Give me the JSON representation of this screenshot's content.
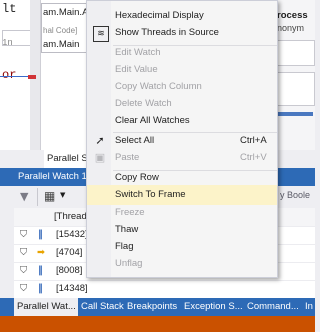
{
  "editor": {
    "code_lines": [
      "lt",
      "1n",
      "or"
    ],
    "colors": {
      "keyword": "#8b0000",
      "accent": "#d13438"
    }
  },
  "callstack_panel": {
    "rows": [
      "am.Main.Ar",
      "hal Code]",
      "am.Main"
    ]
  },
  "right_panel": {
    "header": "rocess",
    "subtext": "nonym"
  },
  "parallel_stacks_tab": "Parallel St",
  "parallel_watch": {
    "title": "Parallel Watch 1 -",
    "search_placeholder": "y Boole",
    "column_header": "[Thread",
    "rows": [
      {
        "thread": "[15432]",
        "icon": "pause-icon"
      },
      {
        "thread": "[4704]",
        "icon": "current-thread-arrow-icon"
      },
      {
        "thread": "[8008]",
        "icon": "pause-icon"
      },
      {
        "thread": "[14348]",
        "icon": "pause-icon"
      }
    ]
  },
  "bottom_tabs": [
    {
      "label": "Parallel Wat...",
      "active": true
    },
    {
      "label": "Call Stack",
      "active": false
    },
    {
      "label": "Breakpoints",
      "active": false
    },
    {
      "label": "Exception S...",
      "active": false
    },
    {
      "label": "Command...",
      "active": false
    },
    {
      "label": "In",
      "active": false
    }
  ],
  "context_menu": {
    "items": [
      {
        "label": "Hexadecimal Display",
        "enabled": true,
        "icon": ""
      },
      {
        "label": "Show Threads in Source",
        "enabled": true,
        "icon": "threads-in-source-icon"
      },
      {
        "label": "Edit Watch",
        "enabled": false
      },
      {
        "label": "Edit Value",
        "enabled": false
      },
      {
        "label": "Copy Watch Column",
        "enabled": false
      },
      {
        "label": "Delete Watch",
        "enabled": false
      },
      {
        "label": "Clear All Watches",
        "enabled": true
      },
      {
        "label": "Select All",
        "enabled": true,
        "shortcut": "Ctrl+A",
        "icon": "cursor-icon"
      },
      {
        "label": "Paste",
        "enabled": false,
        "shortcut": "Ctrl+V",
        "icon": "paste-icon"
      },
      {
        "label": "Copy Row",
        "enabled": true
      },
      {
        "label": "Switch To Frame",
        "enabled": true,
        "highlighted": true
      },
      {
        "label": "Freeze",
        "enabled": false
      },
      {
        "label": "Thaw",
        "enabled": true
      },
      {
        "label": "Flag",
        "enabled": true
      },
      {
        "label": "Unflag",
        "enabled": false
      }
    ]
  },
  "theme": {
    "title_bar_color": "#2d6ab6",
    "status_bar_color": "#ca5100",
    "highlight_color": "#fcf3c9"
  }
}
